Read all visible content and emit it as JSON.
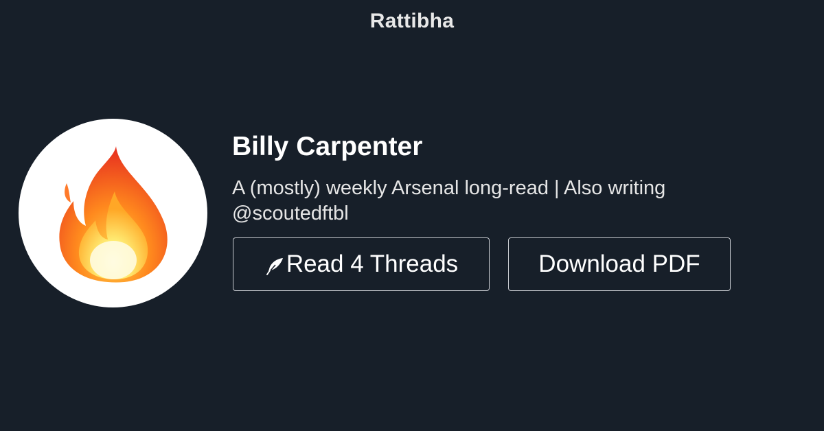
{
  "brand": "Rattibha",
  "profile": {
    "name": "Billy Carpenter",
    "bio": "A (mostly) weekly Arsenal long-read | Also writing @scoutedftbl",
    "avatar_icon": "fire-icon"
  },
  "actions": {
    "read_label": "Read 4 Threads",
    "read_icon": "feather-icon",
    "pdf_label": "Download PDF"
  },
  "colors": {
    "background": "#171f29",
    "button_border": "#c9ccd1"
  }
}
